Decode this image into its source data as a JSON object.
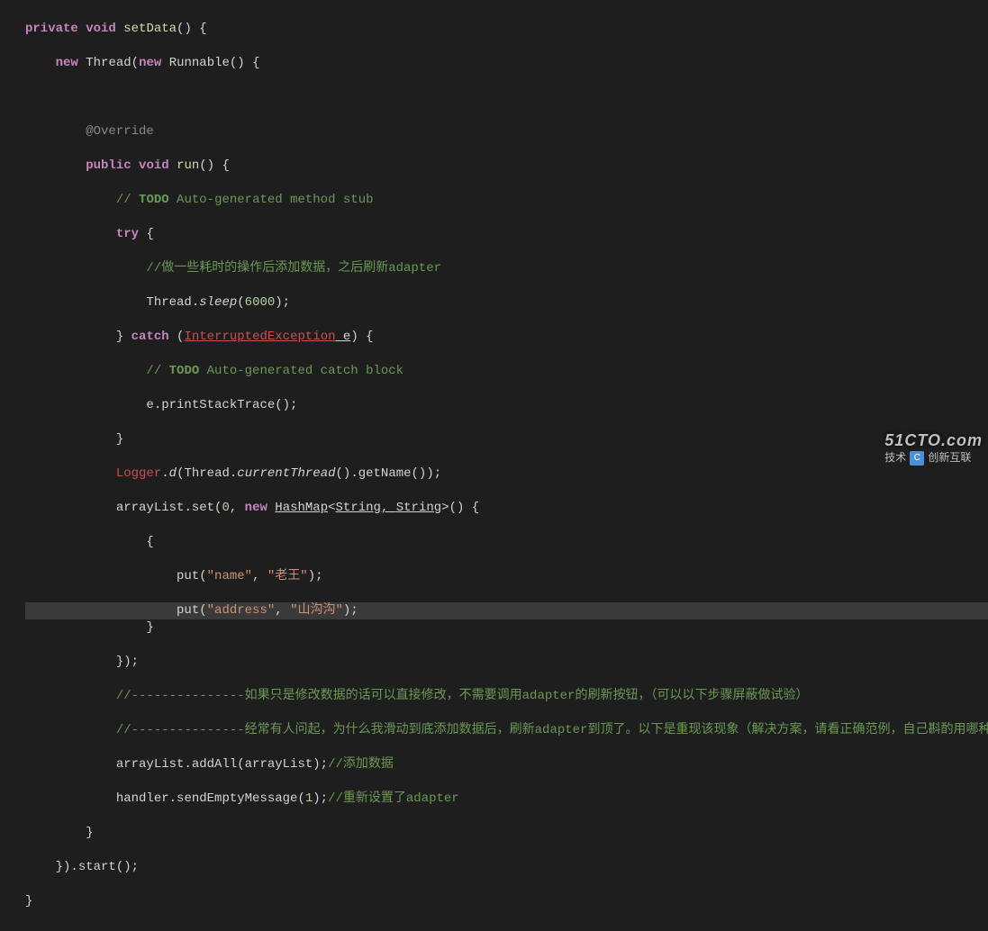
{
  "code": {
    "l1": {
      "kw_private": "private",
      "kw_void": "void",
      "method": "setData",
      "brace": "() {"
    },
    "l2": {
      "kw_new1": "new",
      "cls_thread": "Thread",
      "paren": "(",
      "kw_new2": "new",
      "cls_runnable": "Runnable",
      "tail": "() {"
    },
    "l3": {
      "ann": "@Override"
    },
    "l4": {
      "kw_public": "public",
      "kw_void": "void",
      "method": "run",
      "tail": "() {"
    },
    "l5": {
      "slashes": "// ",
      "todo": "TODO",
      "rest": " Auto-generated method stub"
    },
    "l6": {
      "kw_try": "try",
      "brace": " {"
    },
    "l7": {
      "comment": "//做一些耗时的操作后添加数据，之后刷新adapter"
    },
    "l8": {
      "cls": "Thread",
      "dot": ".",
      "sleep": "sleep",
      "paren": "(",
      "num": "6000",
      "close": ");"
    },
    "l9": {
      "brace": "}",
      "kw_catch": "catch",
      "paren": " (",
      "exc": "InterruptedException",
      "var": " e",
      "close": ") {"
    },
    "l10": {
      "slashes": "// ",
      "todo": "TODO",
      "rest": " Auto-generated catch block"
    },
    "l11": {
      "text": "e.printStackTrace();"
    },
    "l12": {
      "brace": "}"
    },
    "l13": {
      "cls": "Logger",
      "dot": ".",
      "d": "d",
      "paren": "(",
      "thread": "Thread",
      "dot2": ".",
      "current": "currentThread",
      "tail": "().getName());"
    },
    "l14": {
      "arr": "arrayList.set(",
      "zero": "0",
      "comma": ", ",
      "kw_new": "new",
      "space": " ",
      "hashmap": "HashMap",
      "lt": "<",
      "str1": "String",
      "mid": ", ",
      "str2": "String",
      "gt": ">",
      "tail": "() {"
    },
    "l15": {
      "brace": "{"
    },
    "l16": {
      "put": "put(",
      "s1": "\"name\"",
      "comma": ", ",
      "s2": "\"老王\"",
      "close": ");"
    },
    "l17": {
      "put": "put(",
      "s1": "\"address\"",
      "comma": ", ",
      "s2": "\"山沟沟\"",
      "close": ");"
    },
    "l18": {
      "brace": "}"
    },
    "l19": {
      "brace": "});"
    },
    "l20": {
      "comment": "//---------------如果只是修改数据的话可以直接修改，不需要调用adapter的刷新按钮，（可以以下步骤屏蔽做试验）"
    },
    "l21": {
      "comment": "//---------------经常有人问起，为什么我滑动到底添加数据后，刷新adapter到顶了。以下是重现该现象（解决方案，请看正确范例，自己斟酌用哪种方案）"
    },
    "l22": {
      "text": "arrayList.addAll(arrayList);",
      "comment": "//添加数据"
    },
    "l23": {
      "text": "handler.sendEmptyMessage(",
      "num": "1",
      "close": ");",
      "comment": "//重新设置了adapter"
    },
    "l24": {
      "brace": "}"
    },
    "l25": {
      "brace": "}).start();"
    },
    "l26": {
      "brace": "}"
    }
  },
  "watermark": {
    "top": "51CTO.com",
    "logo": "C",
    "bottomLabel": "技术",
    "brand": "创新互联"
  }
}
